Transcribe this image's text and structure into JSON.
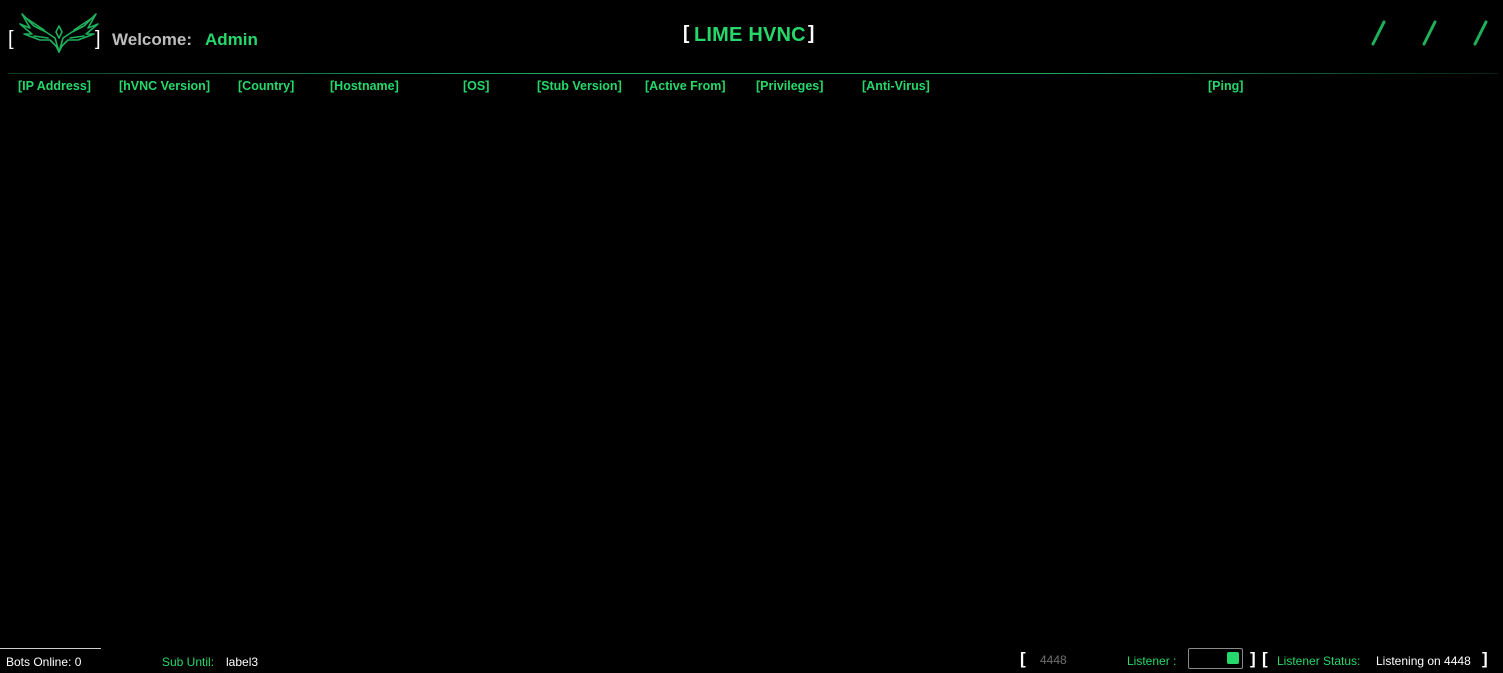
{
  "header": {
    "logo_icon": "phoenix-logo-icon",
    "welcome_label": "Welcome:",
    "user_name": "Admin",
    "title": "LIME HVNC",
    "title_brackets": [
      "[",
      "]"
    ],
    "logo_brackets": [
      "[",
      "]"
    ],
    "window_buttons": [
      "minimize-icon",
      "maximize-icon",
      "close-icon"
    ]
  },
  "table": {
    "columns": [
      "[IP Address]",
      "[hVNC Version]",
      "[Country]",
      "[Hostname]",
      "[OS]",
      "[Stub Version]",
      "[Active From]",
      "[Privileges]",
      "[Anti-Virus]",
      "[Ping]"
    ],
    "rows": []
  },
  "footer": {
    "bots_online": "Bots Online: 0",
    "sub_until_label": "Sub Until:",
    "sub_until_value": "label3",
    "port_value": "4448",
    "listener_label": "Listener :",
    "listener_on": true,
    "listener_status_label": "Listener Status:",
    "listener_status_value": "Listening on 4448",
    "brackets": [
      "[",
      "]",
      "]",
      "[",
      "]"
    ]
  },
  "colors": {
    "accent": "#26d86b",
    "background": "#000000",
    "text": "#ffffff",
    "muted": "#bdbdbd"
  }
}
